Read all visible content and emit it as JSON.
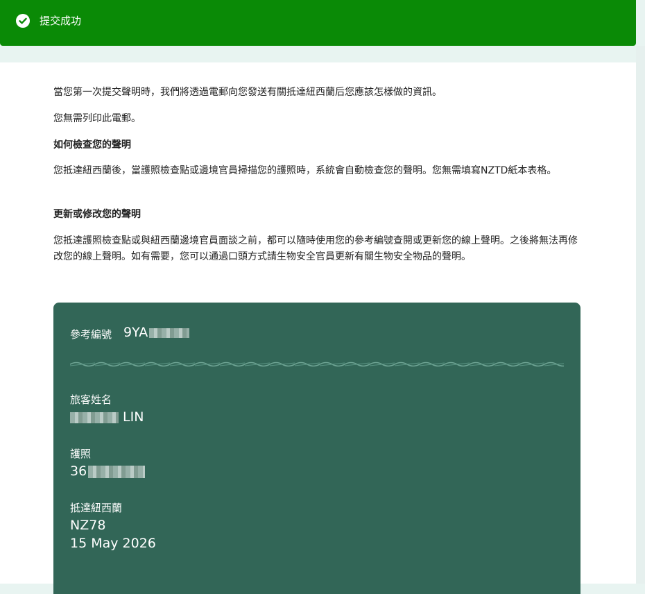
{
  "banner": {
    "title": "提交成功",
    "icon": "check-circle-icon",
    "color": "#0a8a06"
  },
  "content": {
    "intro": "當您第一次提交聲明時，我們將透過電郵向您發送有關抵達紐西蘭后您應該怎樣做的資訊。",
    "no_print": "您無需列印此電郵。",
    "check_heading": "如何檢查您的聲明",
    "check_text": "您抵達紐西蘭後，當護照檢查點或邊境官員掃描您的護照時，系統會自動檢查您的聲明。您無需填寫NZTD紙本表格。",
    "update_heading": "更新或修改您的聲明",
    "update_text": "您抵達護照檢查點或與紐西蘭邊境官員面談之前，都可以隨時使用您的參考編號查閱或更新您的線上聲明。之後將無法再修改您的線上聲明。如有需要，您可以通過口頭方式請生物安全官員更新有關生物安全物品的聲明。"
  },
  "summary": {
    "color": "#326657",
    "reference_label": "參考編號",
    "reference_value": "9YA",
    "traveller_label": "旅客姓名",
    "traveller_value": "LIN",
    "passport_label": "護照",
    "passport_value": "36",
    "arrival_label": "抵達紐西蘭",
    "flight": "NZ78",
    "arrival_date": "15 May 2026"
  }
}
